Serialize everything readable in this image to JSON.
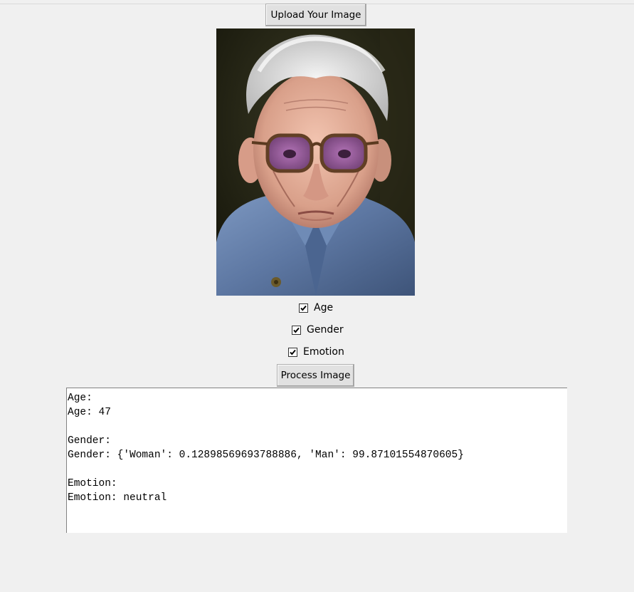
{
  "upload_button": {
    "label": "Upload Your Image"
  },
  "image": {
    "description_icon": "portrait-image"
  },
  "options": [
    {
      "label": "Age",
      "checked": true
    },
    {
      "label": "Gender",
      "checked": true
    },
    {
      "label": "Emotion",
      "checked": true
    }
  ],
  "process_button": {
    "label": "Process Image"
  },
  "output": {
    "lines": [
      "Age:",
      "Age: 47",
      "",
      "Gender:",
      "Gender: {'Woman': 0.12898569693788886, 'Man': 99.87101554870605}",
      "",
      "Emotion:",
      "Emotion: neutral"
    ]
  }
}
